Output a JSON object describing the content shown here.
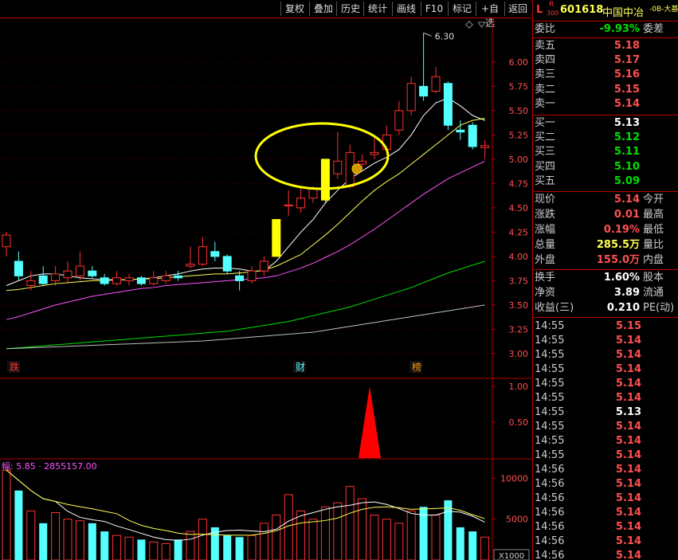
{
  "toolbar": {
    "buttons": [
      "复权",
      "叠加",
      "历史",
      "统计",
      "画线",
      "F10",
      "标记",
      "+自选",
      "返回"
    ]
  },
  "header": {
    "prefix": "L",
    "mark_top": "R",
    "mark_bottom": "300",
    "code": "601618",
    "name": "中国中冶",
    "tag": "-0B-大基"
  },
  "colors": {
    "up": "#ff3232",
    "down": "#54ffff",
    "ma5": "#ffffff",
    "ma10": "#ffff54",
    "ma20": "#ff54ff",
    "ma60": "#00e000",
    "ma120": "#c0c0c0",
    "yellow_highlight": "#ffff00",
    "border": "#b00000",
    "signal": "#ff0000"
  },
  "order_book": {
    "ratio_label": "委比",
    "ratio_value": "-9.93%",
    "diff_label": "委差",
    "sells": [
      {
        "label": "卖五",
        "price": "5.18"
      },
      {
        "label": "卖四",
        "price": "5.17"
      },
      {
        "label": "卖三",
        "price": "5.16"
      },
      {
        "label": "卖二",
        "price": "5.15"
      },
      {
        "label": "卖一",
        "price": "5.14"
      }
    ],
    "buys": [
      {
        "label": "买一",
        "price": "5.13"
      },
      {
        "label": "买二",
        "price": "5.12"
      },
      {
        "label": "买三",
        "price": "5.11"
      },
      {
        "label": "买四",
        "price": "5.10"
      },
      {
        "label": "买五",
        "price": "5.09"
      }
    ]
  },
  "quote": {
    "rows": [
      {
        "l": "现价",
        "v": "5.14",
        "r": "今开",
        "c": "#ff5050"
      },
      {
        "l": "涨跌",
        "v": "0.01",
        "r": "最高",
        "c": "#ff5050"
      },
      {
        "l": "涨幅",
        "v": "0.19%",
        "r": "最低",
        "c": "#ff5050"
      },
      {
        "l": "总量",
        "v": "285.5万",
        "r": "量比",
        "c": "#ffff54"
      },
      {
        "l": "外盘",
        "v": "155.0万",
        "r": "内盘",
        "c": "#ff5050"
      }
    ],
    "rows2": [
      {
        "l": "换手",
        "v": "1.60%",
        "r": "股本",
        "c": "#ffffff"
      },
      {
        "l": "净资",
        "v": "3.89",
        "r": "流通",
        "c": "#ffffff"
      },
      {
        "l": "收益(三)",
        "v": "0.210",
        "r": "PE(动)",
        "c": "#ffffff"
      }
    ]
  },
  "ticks": [
    {
      "t": "14:55",
      "p": "5.15",
      "c": "#ff5050"
    },
    {
      "t": "14:55",
      "p": "5.14",
      "c": "#ff5050"
    },
    {
      "t": "14:55",
      "p": "5.14",
      "c": "#ff5050"
    },
    {
      "t": "14:55",
      "p": "5.14",
      "c": "#ff5050"
    },
    {
      "t": "14:55",
      "p": "5.14",
      "c": "#ff5050"
    },
    {
      "t": "14:55",
      "p": "5.14",
      "c": "#ff5050"
    },
    {
      "t": "14:55",
      "p": "5.13",
      "c": "#ffffff"
    },
    {
      "t": "14:55",
      "p": "5.14",
      "c": "#ff5050"
    },
    {
      "t": "14:55",
      "p": "5.14",
      "c": "#ff5050"
    },
    {
      "t": "14:55",
      "p": "5.14",
      "c": "#ff5050"
    },
    {
      "t": "14:56",
      "p": "5.14",
      "c": "#ff5050"
    },
    {
      "t": "14:56",
      "p": "5.14",
      "c": "#ff5050"
    },
    {
      "t": "14:56",
      "p": "5.14",
      "c": "#ff5050"
    },
    {
      "t": "14:56",
      "p": "5.14",
      "c": "#ff5050"
    },
    {
      "t": "14:56",
      "p": "5.14",
      "c": "#ff5050"
    },
    {
      "t": "14:56",
      "p": "5.14",
      "c": "#ff5050"
    },
    {
      "t": "14:56",
      "p": "5.14",
      "c": "#ff5050"
    }
  ],
  "chart_data": {
    "type": "candlestick",
    "price_axis": {
      "ticks": [
        "6.00",
        "5.75",
        "5.50",
        "5.25",
        "5.00",
        "4.75",
        "4.50",
        "4.25",
        "4.00",
        "3.75",
        "3.50",
        "3.25",
        "3.00"
      ],
      "min": 2.95,
      "max": 6.45
    },
    "high_annotation": "6.30",
    "high_value": 6.3,
    "markers": [
      {
        "text": "跌",
        "color": "#ff3232"
      },
      {
        "text": "财",
        "color": "#54ffff"
      },
      {
        "text": "榜",
        "color": "#ff9900"
      }
    ],
    "candles": [
      [
        4.1,
        4.22,
        4.0,
        4.25
      ],
      [
        3.95,
        3.8,
        3.75,
        4.05
      ],
      [
        3.7,
        3.75,
        3.65,
        3.85
      ],
      [
        3.8,
        3.72,
        3.7,
        3.9
      ],
      [
        3.75,
        3.82,
        3.7,
        3.9
      ],
      [
        3.78,
        3.85,
        3.72,
        3.95
      ],
      [
        3.8,
        3.9,
        3.75,
        4.05
      ],
      [
        3.85,
        3.8,
        3.78,
        3.9
      ],
      [
        3.78,
        3.72,
        3.7,
        3.82
      ],
      [
        3.72,
        3.78,
        3.7,
        3.85
      ],
      [
        3.75,
        3.78,
        3.7,
        3.82
      ],
      [
        3.78,
        3.72,
        3.7,
        3.8
      ],
      [
        3.72,
        3.78,
        3.7,
        3.85
      ],
      [
        3.75,
        3.8,
        3.72,
        3.85
      ],
      [
        3.8,
        3.78,
        3.75,
        3.85
      ],
      [
        3.9,
        3.92,
        3.88,
        4.1
      ],
      [
        3.92,
        4.1,
        3.9,
        4.2
      ],
      [
        4.05,
        4.0,
        3.95,
        4.15
      ],
      [
        4.0,
        3.85,
        3.82,
        4.02
      ],
      [
        3.8,
        3.75,
        3.65,
        3.85
      ],
      [
        3.75,
        3.85,
        3.72,
        3.9
      ],
      [
        3.85,
        3.95,
        3.8,
        4.0
      ],
      [
        4.0,
        4.38,
        4.0,
        4.38
      ],
      [
        4.52,
        4.53,
        4.42,
        4.68
      ],
      [
        4.5,
        4.6,
        4.45,
        4.7
      ],
      [
        4.6,
        4.7,
        4.55,
        4.72
      ],
      [
        4.58,
        5.0,
        4.55,
        5.0
      ],
      [
        4.85,
        4.98,
        4.8,
        5.28
      ],
      [
        4.72,
        5.07,
        4.7,
        5.15
      ],
      [
        4.95,
        4.98,
        4.9,
        5.05
      ],
      [
        5.05,
        5.07,
        5.0,
        5.25
      ],
      [
        5.1,
        5.25,
        5.05,
        5.35
      ],
      [
        5.3,
        5.5,
        5.25,
        5.6
      ],
      [
        5.5,
        5.78,
        5.45,
        5.85
      ],
      [
        5.75,
        5.65,
        5.6,
        6.3
      ],
      [
        5.7,
        5.85,
        5.68,
        5.95
      ],
      [
        5.78,
        5.35,
        5.3,
        5.8
      ],
      [
        5.3,
        5.28,
        5.2,
        5.4
      ],
      [
        5.35,
        5.13,
        5.1,
        5.38
      ],
      [
        5.12,
        5.14,
        5.0,
        5.2
      ]
    ],
    "ma_series": {
      "ma5": [
        3.7,
        3.75,
        3.8,
        3.82,
        3.82,
        3.8,
        3.78,
        3.77,
        3.76,
        3.76,
        3.76,
        3.77,
        3.78,
        3.8,
        3.82,
        3.85,
        3.87,
        3.88,
        3.88,
        3.87,
        3.85,
        3.85,
        3.95,
        4.1,
        4.25,
        4.38,
        4.55,
        4.68,
        4.8,
        4.88,
        4.96,
        5.02,
        5.1,
        5.25,
        5.45,
        5.58,
        5.63,
        5.55,
        5.45,
        5.4
      ],
      "ma10": [
        3.65,
        3.66,
        3.68,
        3.7,
        3.72,
        3.73,
        3.74,
        3.75,
        3.75,
        3.76,
        3.76,
        3.77,
        3.77,
        3.78,
        3.79,
        3.8,
        3.81,
        3.82,
        3.82,
        3.83,
        3.84,
        3.86,
        3.9,
        3.96,
        4.02,
        4.12,
        4.22,
        4.33,
        4.45,
        4.57,
        4.68,
        4.77,
        4.85,
        4.95,
        5.05,
        5.15,
        5.25,
        5.35,
        5.4,
        5.42
      ],
      "ma20": [
        3.35,
        3.38,
        3.42,
        3.46,
        3.5,
        3.53,
        3.56,
        3.59,
        3.61,
        3.63,
        3.65,
        3.67,
        3.68,
        3.7,
        3.71,
        3.72,
        3.73,
        3.74,
        3.75,
        3.76,
        3.77,
        3.78,
        3.8,
        3.84,
        3.88,
        3.93,
        3.99,
        4.05,
        4.12,
        4.2,
        4.28,
        4.37,
        4.46,
        4.55,
        4.64,
        4.72,
        4.8,
        4.86,
        4.92,
        4.98
      ],
      "ma60": [
        3.05,
        3.06,
        3.07,
        3.08,
        3.09,
        3.1,
        3.11,
        3.12,
        3.13,
        3.14,
        3.15,
        3.16,
        3.17,
        3.18,
        3.19,
        3.2,
        3.21,
        3.22,
        3.23,
        3.25,
        3.27,
        3.29,
        3.31,
        3.33,
        3.36,
        3.39,
        3.42,
        3.45,
        3.48,
        3.52,
        3.56,
        3.6,
        3.64,
        3.68,
        3.73,
        3.78,
        3.83,
        3.87,
        3.91,
        3.95
      ],
      "ma120": [
        3.05,
        3.055,
        3.06,
        3.065,
        3.07,
        3.075,
        3.08,
        3.085,
        3.09,
        3.095,
        3.1,
        3.105,
        3.11,
        3.115,
        3.12,
        3.125,
        3.13,
        3.14,
        3.15,
        3.16,
        3.17,
        3.18,
        3.19,
        3.2,
        3.21,
        3.22,
        3.24,
        3.26,
        3.28,
        3.3,
        3.32,
        3.34,
        3.36,
        3.38,
        3.4,
        3.42,
        3.44,
        3.46,
        3.48,
        3.5
      ]
    },
    "indicator": {
      "ticks": [
        "1.00",
        "0.50"
      ],
      "min": 0,
      "max": 1.08,
      "spike_index": 30,
      "spike_value": 1.0
    },
    "volume": {
      "label": "幅: 5.85 · 2855157.00",
      "ticks": [
        "10000",
        "5000"
      ],
      "unit": "X1000",
      "max": 11500,
      "values": [
        11000,
        8500,
        6000,
        4500,
        5800,
        5000,
        4800,
        4500,
        3500,
        3000,
        2800,
        2500,
        2200,
        2000,
        2500,
        3500,
        5000,
        4000,
        3000,
        2800,
        3000,
        4500,
        5500,
        8000,
        6000,
        5000,
        6500,
        7000,
        9000,
        7500,
        5500,
        5000,
        4500,
        6000,
        6500,
        5500,
        7300,
        4000,
        3500,
        2800
      ]
    }
  }
}
